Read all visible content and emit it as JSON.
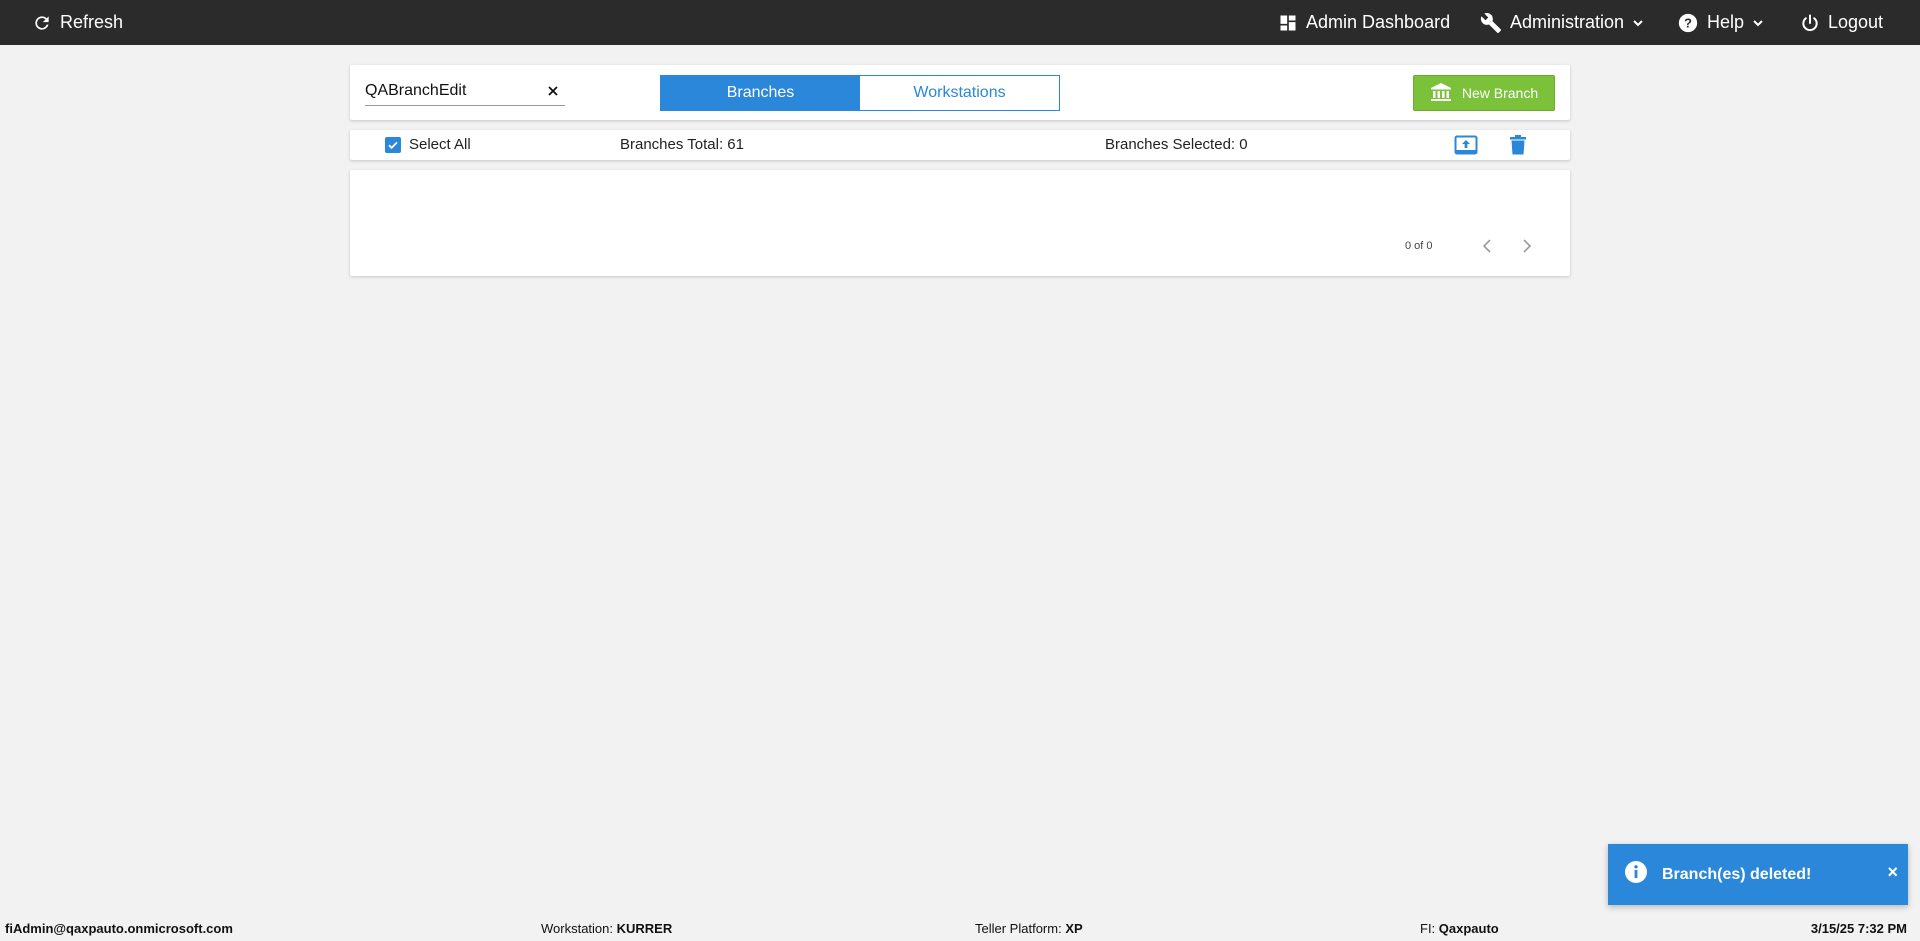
{
  "nav": {
    "refresh": "Refresh",
    "admin_dashboard": "Admin Dashboard",
    "administration": "Administration",
    "help": "Help",
    "logout": "Logout"
  },
  "search": {
    "value": "QABranchEdit",
    "clear_icon": "close-icon"
  },
  "tabs": [
    {
      "label": "Branches",
      "active": true
    },
    {
      "label": "Workstations",
      "active": false
    }
  ],
  "actions": {
    "new_branch": "New Branch"
  },
  "summary": {
    "select_all": "Select All",
    "branches_total": "Branches Total: 61",
    "branches_selected": "Branches Selected: 0"
  },
  "pager": {
    "text": "0 of 0"
  },
  "toast": {
    "message": "Branch(es) deleted!",
    "close": "×"
  },
  "status": {
    "user": "fiAdmin@qaxpauto.onmicrosoft.com",
    "workstation_label": "Workstation: ",
    "workstation_value": "KURRER",
    "platform_label": "Teller Platform: ",
    "platform_value": "XP",
    "fi_label": "FI: ",
    "fi_value": "Qaxpauto",
    "datetime": "3/15/25 7:32 PM"
  },
  "colors": {
    "topbar": "#2b2b2b",
    "accent": "#2b87da",
    "new_branch": "#7cc13a",
    "background": "#f2f2f2"
  }
}
